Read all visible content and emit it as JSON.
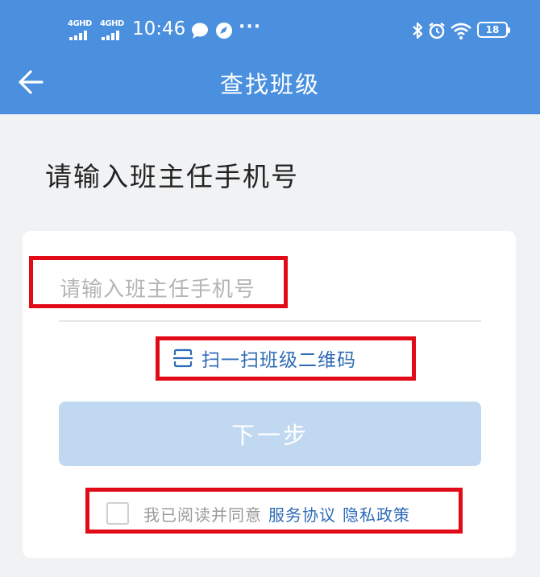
{
  "status_bar": {
    "sim1_label": "4GHD",
    "sim2_label": "4GHD",
    "time": "10:46",
    "more": "···",
    "battery": "18",
    "icons": [
      "signal-icon",
      "chat-bubble-icon",
      "compass-icon",
      "bluetooth-icon",
      "alarm-icon",
      "wifi-icon",
      "battery-icon"
    ]
  },
  "nav": {
    "back_icon": "arrow-left-icon",
    "title": "查找班级"
  },
  "page": {
    "heading": "请输入班主任手机号"
  },
  "form": {
    "phone_value": "",
    "phone_placeholder": "请输入班主任手机号",
    "scan_icon": "scan-icon",
    "scan_label": "扫一扫班级二维码",
    "next_label": "下一步",
    "agree_checked": false,
    "agree_text": "我已阅读并同意",
    "service_link": "服务协议",
    "privacy_link": "隐私政策"
  },
  "colors": {
    "header": "#4a90df",
    "link": "#2f6bb8",
    "button_disabled": "#c1d8f1",
    "highlight_box": "#e10a17"
  }
}
